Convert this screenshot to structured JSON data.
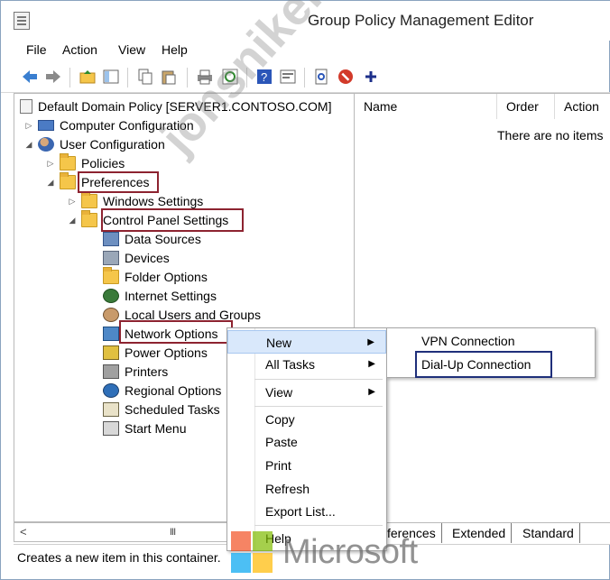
{
  "window": {
    "title": "Group Policy Management Editor"
  },
  "menubar": {
    "file": "File",
    "action": "Action",
    "view": "View",
    "help": "Help"
  },
  "tree": {
    "root": "Default Domain Policy [SERVER1.CONTOSO.COM]",
    "computer_configuration": "Computer Configuration",
    "user_configuration": "User Configuration",
    "policies": "Policies",
    "preferences": "Preferences",
    "windows_settings": "Windows Settings",
    "control_panel_settings": "Control Panel Settings",
    "children": [
      "Data Sources",
      "Devices",
      "Folder Options",
      "Internet Settings",
      "Local Users and Groups",
      "Network Options",
      "Power Options",
      "Printers",
      "Regional Options",
      "Scheduled Tasks",
      "Start Menu"
    ]
  },
  "list": {
    "columns": [
      "Name",
      "Order",
      "Action"
    ],
    "empty_text": "There are no items"
  },
  "tabs": {
    "preferences_partial": "ferences",
    "extended": "Extended",
    "standard": "Standard"
  },
  "scrollbar": {
    "thumb": "III",
    "left_arrow": "<"
  },
  "status": "Creates a new item in this container.",
  "context_menu": {
    "new": "New",
    "all_tasks": "All Tasks",
    "view": "View",
    "copy": "Copy",
    "paste": "Paste",
    "print": "Print",
    "refresh": "Refresh",
    "export_list": "Export List...",
    "help": "Help"
  },
  "submenu": {
    "vpn": "VPN Connection",
    "dialup": "Dial-Up Connection"
  },
  "watermark": "jonsniken.com",
  "logo_text": "Microsoft",
  "colors": {
    "highlight_red": "#8d2330",
    "highlight_blue": "#1f2f7a",
    "menu_hover": "#d9e8fb"
  }
}
